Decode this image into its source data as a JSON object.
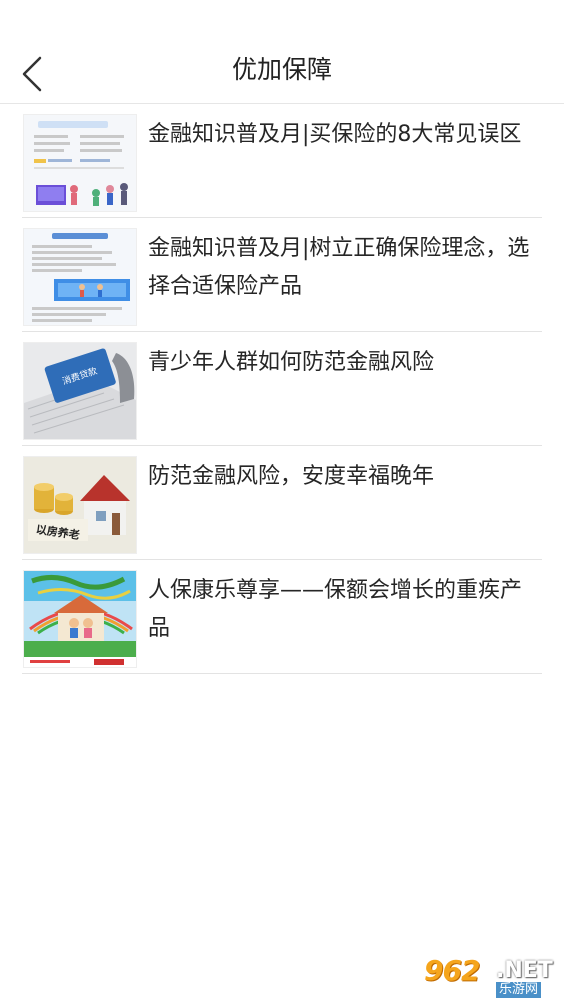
{
  "header": {
    "title": "优加保障",
    "back_icon": "chevron-left-icon"
  },
  "articles": [
    {
      "title": "金融知识普及月|买保险的8大常见误区",
      "thumb": "infographic-thumbnail"
    },
    {
      "title": "金融知识普及月|树立正确保险理念，选择合适保险产品",
      "thumb": "infographic-thumbnail"
    },
    {
      "title": "青少年人群如何防范金融风险",
      "thumb": "card-keyboard-photo",
      "thumb_text": "消费贷款"
    },
    {
      "title": "防范金融风险，安度幸福晚年",
      "thumb": "house-coins-photo",
      "thumb_text": "以房养老"
    },
    {
      "title": "人保康乐尊享——保额会增长的重疾产品",
      "thumb": "insurance-poster"
    }
  ],
  "watermark": {
    "number": "962",
    "suffix": ".NET",
    "site": "乐游网"
  },
  "colors": {
    "divider": "#e3e3e3",
    "text": "#262626",
    "watermark": "#f5a51c"
  }
}
